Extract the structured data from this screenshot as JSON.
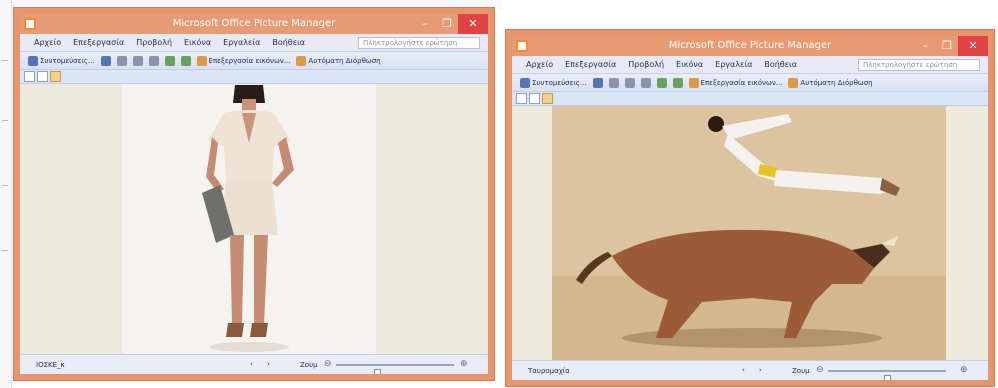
{
  "windows": [
    {
      "title": "Microsoft Office Picture Manager",
      "menu": [
        "Αρχείο",
        "Επεξεργασία",
        "Προβολή",
        "Εικόνα",
        "Εργαλεία",
        "Βοήθεια"
      ],
      "help_placeholder": "Πληκτρολογήστε ερώτηση",
      "toolbar": {
        "shortcuts_label": "Συντομεύσεις...",
        "edit_label": "Επεξεργασία εικόνων...",
        "autocorrect_label": "Αυτόματη Διόρθωση"
      },
      "status": {
        "filename": "ΙΟΣΚΕ_κ",
        "nav": "‹ ›",
        "zoom_label": "Ζουμ"
      },
      "zoom_level": 0.35
    },
    {
      "title": "Microsoft Office Picture Manager",
      "menu": [
        "Αρχείο",
        "Επεξεργασία",
        "Προβολή",
        "Εικόνα",
        "Εργαλεία",
        "Βοήθεια"
      ],
      "help_placeholder": "Πληκτρολογήστε ερώτηση",
      "toolbar": {
        "shortcuts_label": "Συντομεύσεις...",
        "edit_label": "Επεξεργασία εικόνων...",
        "autocorrect_label": "Αυτόματη Διόρθωση"
      },
      "status": {
        "filename": "Ταυρομαχία",
        "nav": "‹ ›",
        "zoom_label": "Ζουμ"
      },
      "zoom_level": 0.5
    }
  ],
  "colors": {
    "frame": "#e7956c",
    "close": "#e04343",
    "menu_bg": "#e7eaf4"
  }
}
